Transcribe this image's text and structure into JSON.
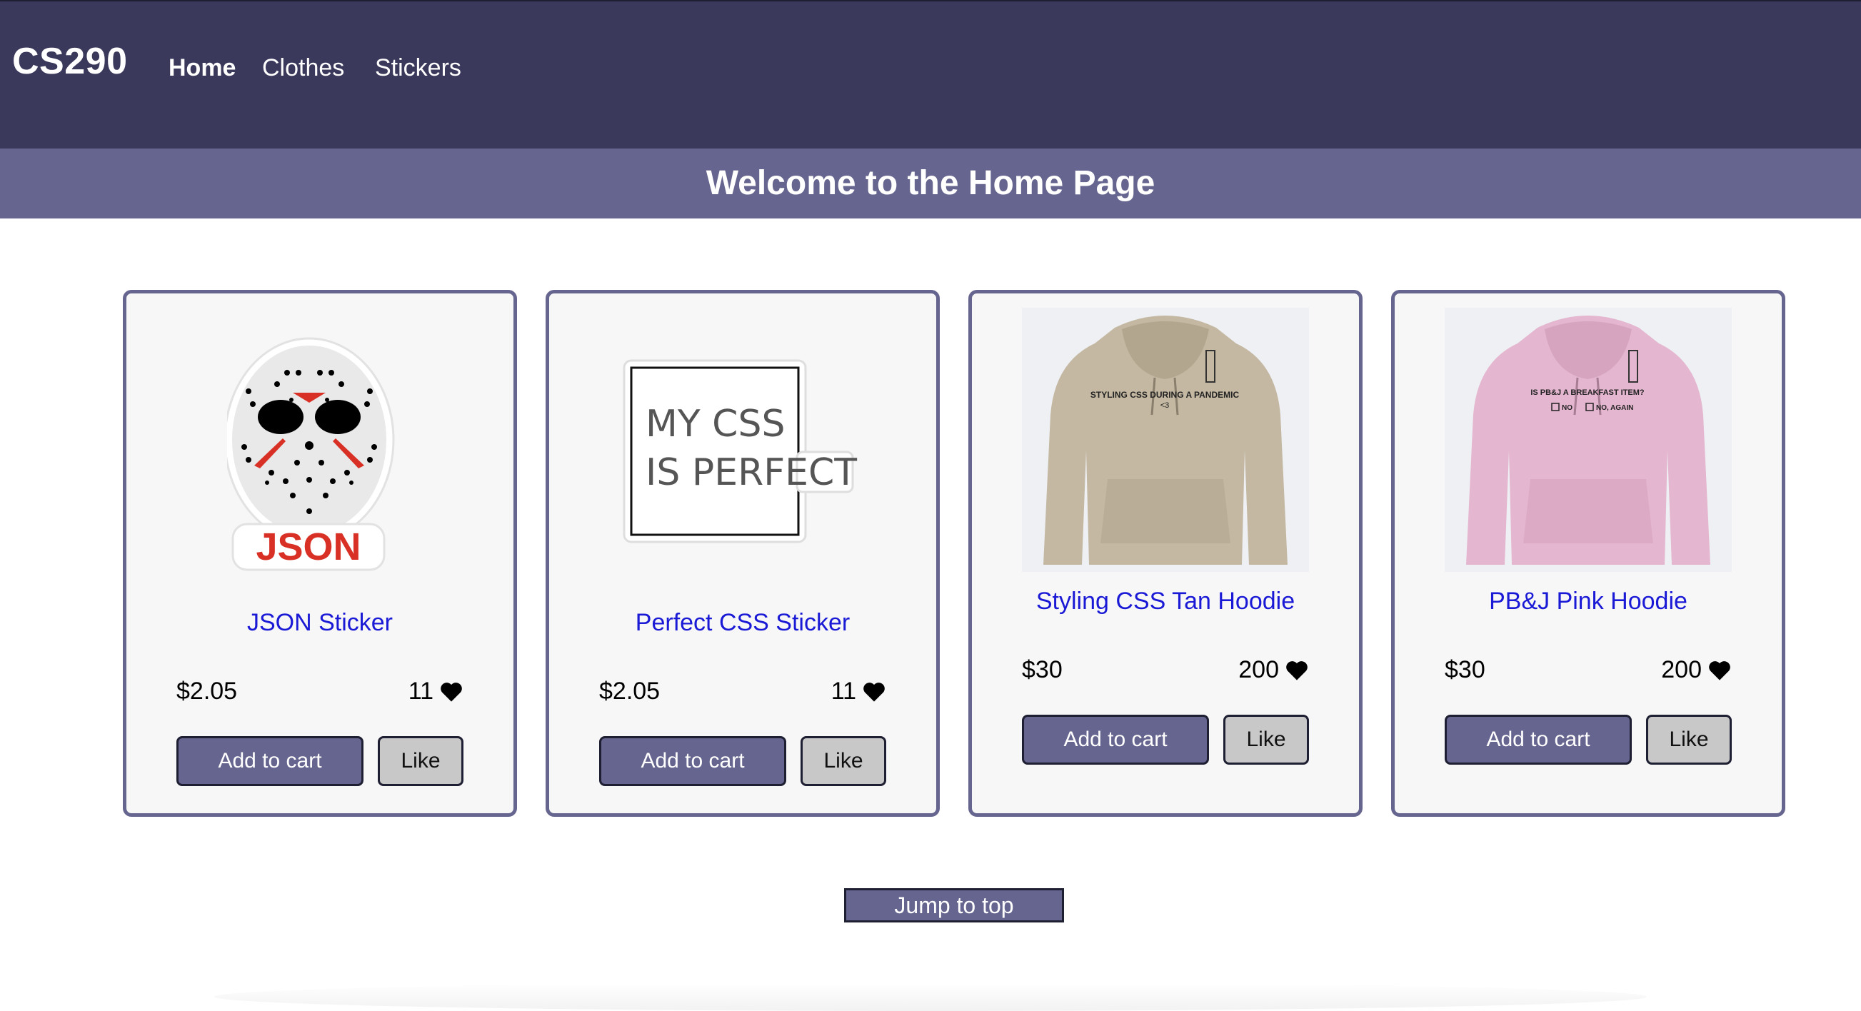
{
  "nav": {
    "brand": "CS290",
    "links": [
      "Home",
      "Clothes",
      "Stickers"
    ]
  },
  "banner": {
    "title": "Welcome to the Home Page"
  },
  "products": [
    {
      "title": "JSON Sticker",
      "price": "$2.05",
      "likes": "11",
      "cart_label": "Add to cart",
      "like_label": "Like",
      "image_text": "JSON"
    },
    {
      "title": "Perfect CSS Sticker",
      "price": "$2.05",
      "likes": "11",
      "cart_label": "Add to cart",
      "like_label": "Like",
      "image_line1": "MY CSS",
      "image_line2": "IS PERFECT"
    },
    {
      "title": "Styling CSS Tan Hoodie",
      "price": "$30",
      "likes": "200",
      "cart_label": "Add to cart",
      "like_label": "Like",
      "image_text": "STYLING CSS DURING A PANDEMIC",
      "image_text2": "<3"
    },
    {
      "title": "PB&J Pink Hoodie",
      "price": "$30",
      "likes": "200",
      "cart_label": "Add to cart",
      "like_label": "Like",
      "image_text": "IS PB&J A BREAKFAST ITEM?",
      "opt1": "NO",
      "opt2": "NO, AGAIN"
    }
  ],
  "footer": {
    "jump_label": "Jump to top"
  },
  "colors": {
    "nav_bg": "#3a395b",
    "accent": "#66658f",
    "link": "#1a1ad6",
    "card_bg": "#f7f7f7"
  }
}
